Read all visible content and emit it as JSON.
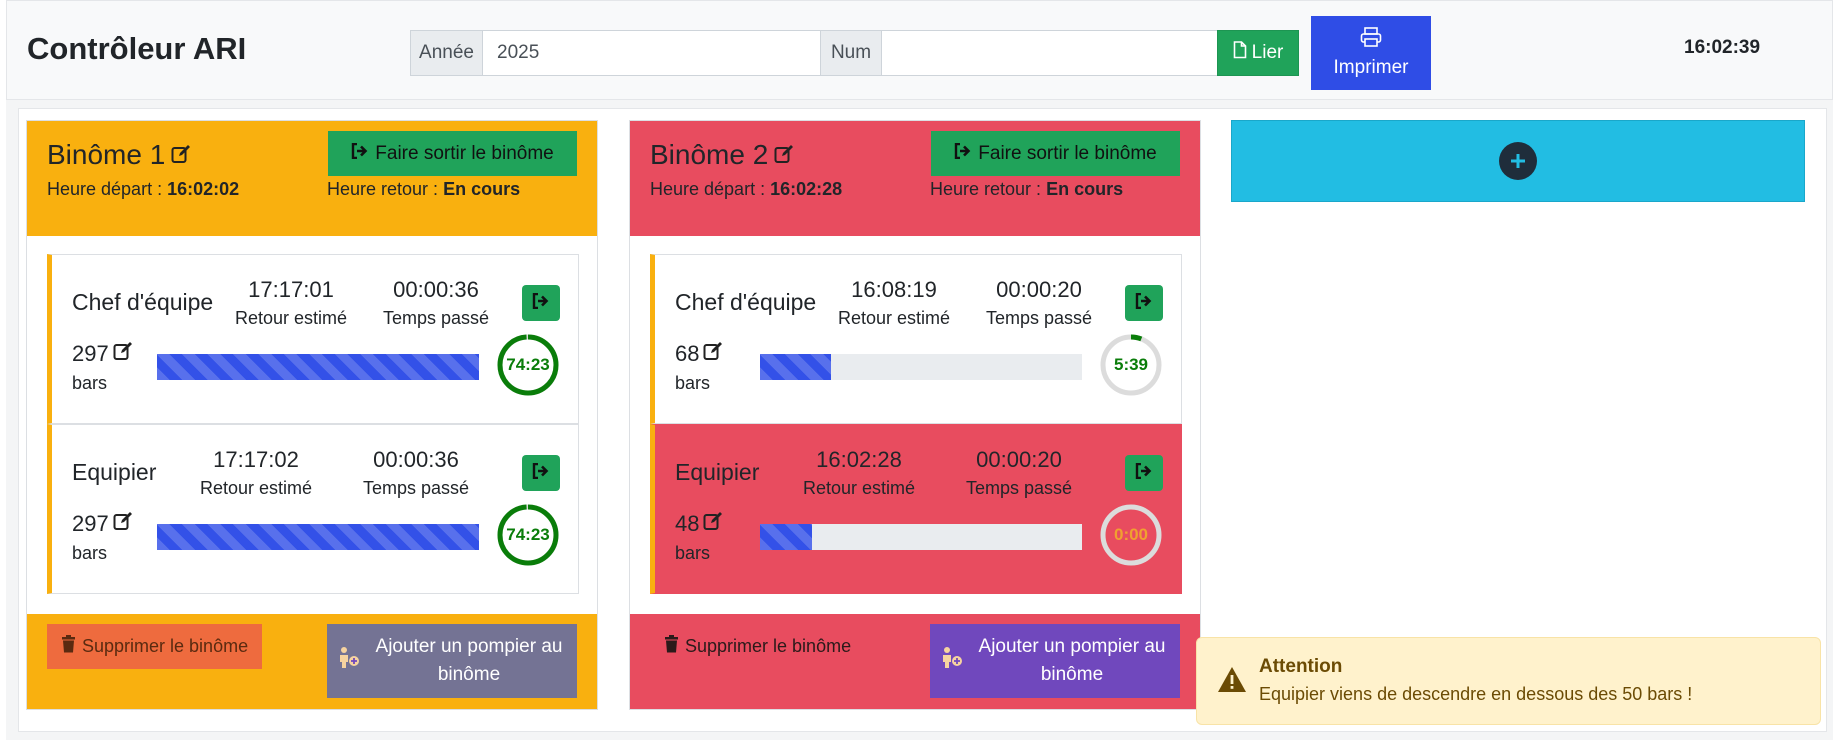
{
  "app": {
    "title": "Contrôleur ARI",
    "clock": "16:02:39"
  },
  "header": {
    "year_label": "Année",
    "year_value": "2025",
    "num_label": "Num",
    "num_value": "",
    "lier_label": "Lier",
    "print_label": "Imprimer"
  },
  "colors": {
    "warning": "#f9b00f",
    "danger": "#e84c5f",
    "success": "#20a35a",
    "primary": "#2f4de6",
    "info": "#22bde3",
    "purple": "#7048bd"
  },
  "binomes": [
    {
      "title": "Binôme 1",
      "status_color": "#f9b00f",
      "exit_label": "Faire sortir le binôme",
      "depart_label": "Heure départ : ",
      "depart_value": "16:02:02",
      "retour_label": "Heure retour : ",
      "retour_value": "En cours",
      "delete_label": "Supprimer le binôme",
      "add_label": "Ajouter un pompier au binôme",
      "members": [
        {
          "role": "Chef d'équipe",
          "retour_estime": "17:17:01",
          "retour_estime_label": "Retour estimé",
          "temps_passe": "00:00:36",
          "temps_passe_label": "Temps passé",
          "pressure": "297",
          "unit": "bars",
          "pressure_fraction": 1.0,
          "timer": "74:23",
          "timer_fraction": 0.99,
          "timer_color": "#0a7d0a",
          "alert": false
        },
        {
          "role": "Equipier",
          "retour_estime": "17:17:02",
          "retour_estime_label": "Retour estimé",
          "temps_passe": "00:00:36",
          "temps_passe_label": "Temps passé",
          "pressure": "297",
          "unit": "bars",
          "pressure_fraction": 1.0,
          "timer": "74:23",
          "timer_fraction": 0.99,
          "timer_color": "#0a7d0a",
          "alert": false
        }
      ]
    },
    {
      "title": "Binôme 2",
      "status_color": "#e84c5f",
      "exit_label": "Faire sortir le binôme",
      "depart_label": "Heure départ : ",
      "depart_value": "16:02:28",
      "retour_label": "Heure retour : ",
      "retour_value": "En cours",
      "delete_label": "Supprimer le binôme",
      "add_label": "Ajouter un pompier au binôme",
      "members": [
        {
          "role": "Chef d'équipe",
          "retour_estime": "16:08:19",
          "retour_estime_label": "Retour estimé",
          "temps_passe": "00:00:20",
          "temps_passe_label": "Temps passé",
          "pressure": "68",
          "unit": "bars",
          "pressure_fraction": 0.22,
          "timer": "5:39",
          "timer_fraction": 0.06,
          "timer_color": "#0a7d0a",
          "alert": false
        },
        {
          "role": "Equipier",
          "retour_estime": "16:02:28",
          "retour_estime_label": "Retour estimé",
          "temps_passe": "00:00:20",
          "temps_passe_label": "Temps passé",
          "pressure": "48",
          "unit": "bars",
          "pressure_fraction": 0.16,
          "timer": "0:00",
          "timer_fraction": 0.0,
          "timer_color": "#f0a030",
          "alert": true
        }
      ]
    }
  ],
  "toast": {
    "title": "Attention",
    "message": "Equipier viens de descendre en dessous des 50 bars !"
  },
  "icons": {
    "edit": "edit-icon",
    "exit": "sign-out-icon",
    "file": "file-icon",
    "print": "printer-icon",
    "trash": "trash-icon",
    "add_person": "person-add-icon",
    "plus": "plus-circle-icon",
    "warning": "warning-triangle-icon"
  }
}
